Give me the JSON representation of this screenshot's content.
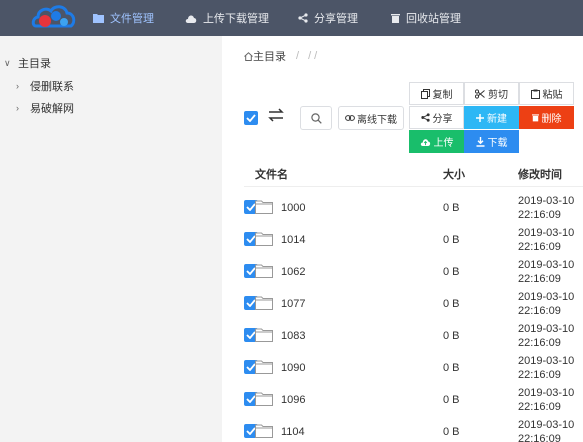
{
  "topbar": {
    "nav": [
      {
        "label": "文件管理",
        "icon": "folder-icon",
        "active": true
      },
      {
        "label": "上传下载管理",
        "icon": "cloud-icon"
      },
      {
        "label": "分享管理",
        "icon": "share-icon"
      },
      {
        "label": "回收站管理",
        "icon": "trash-icon"
      }
    ]
  },
  "sidebar": {
    "root": "主目录",
    "children": [
      "侵删联系",
      "易破解网"
    ]
  },
  "breadcrumb": {
    "root": "主目录",
    "sep": "/ //"
  },
  "toolbar": {
    "offline_download": "离线下载",
    "copy": "复制",
    "cut": "剪切",
    "paste": "粘贴",
    "share": "分享",
    "new": "新建",
    "delete": "删除",
    "upload": "上传",
    "download": "下载"
  },
  "table": {
    "headers": {
      "name": "文件名",
      "size": "大小",
      "mtime": "修改时间"
    },
    "rows": [
      {
        "name": "1000",
        "size": "0 B",
        "mtime": "2019-03-10 22:16:09"
      },
      {
        "name": "1014",
        "size": "0 B",
        "mtime": "2019-03-10 22:16:09"
      },
      {
        "name": "1062",
        "size": "0 B",
        "mtime": "2019-03-10 22:16:09"
      },
      {
        "name": "1077",
        "size": "0 B",
        "mtime": "2019-03-10 22:16:09"
      },
      {
        "name": "1083",
        "size": "0 B",
        "mtime": "2019-03-10 22:16:09"
      },
      {
        "name": "1090",
        "size": "0 B",
        "mtime": "2019-03-10 22:16:09"
      },
      {
        "name": "1096",
        "size": "0 B",
        "mtime": "2019-03-10 22:16:09"
      },
      {
        "name": "1104",
        "size": "0 B",
        "mtime": "2019-03-10 22:16:09"
      }
    ]
  },
  "colors": {
    "topbar": "#4c5567",
    "primary": "#2d8cf0",
    "info": "#2db7f5",
    "danger": "#ed4014",
    "success": "#19be6b"
  }
}
